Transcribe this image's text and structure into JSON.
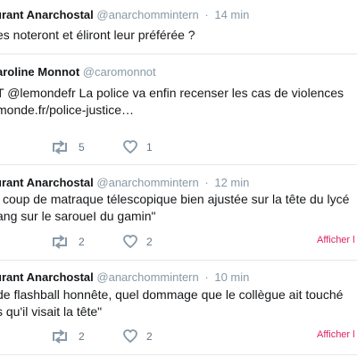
{
  "tweets": [
    {
      "name": "urant Anarchostal",
      "handle": "@anarchommintern",
      "time": "14 min",
      "lines": [
        "es noteront et éliront leur préférée ?"
      ]
    },
    {
      "name": "aroline Monnot",
      "handle": "@caromonnot",
      "lines": [
        "T @lemondefr La police va enfin recenser les cas de violences",
        "monde.fr/police-justice…"
      ],
      "retweets": "5",
      "likes": "1"
    },
    {
      "name": "urant Anarchostal",
      "handle": "@anarchommintern",
      "time": "12 min",
      "lines": [
        "i coup de matraque télescopique bien ajustée sur la tête du lycé",
        "ang sur le saroueI du gamin\""
      ],
      "retweets": "2",
      "likes": "2",
      "show_label": "Afficher l"
    },
    {
      "name": "urant Anarchostal",
      "handle": "@anarchommintern",
      "time": "10 min",
      "lines": [
        "de flashball honnête, quel dommage que le collègue ait touché",
        "s qu'il visait la tête\""
      ],
      "retweets": "2",
      "likes": "2",
      "show_label": "Afficher l"
    }
  ],
  "icons": {
    "retweet": "retweet-icon",
    "like": "heart-icon"
  },
  "colors": {
    "text": "#14171a",
    "muted": "#8899a6",
    "divider": "#e1e8ed",
    "show_more": "#e0245e"
  }
}
